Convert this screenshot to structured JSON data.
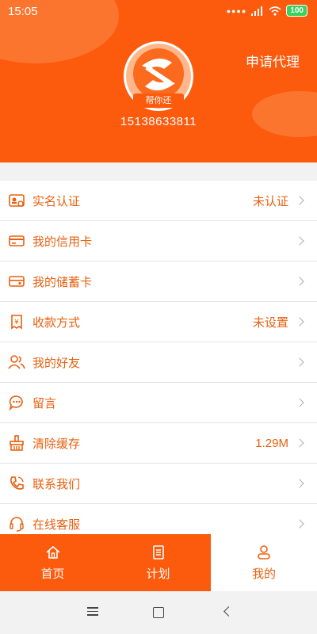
{
  "status_bar": {
    "time": "15:05",
    "battery": "100"
  },
  "header": {
    "apply_agent_label": "申请代理",
    "avatar_text": "帮你还",
    "phone": "15138633811"
  },
  "menu": {
    "items": [
      {
        "label": "实名认证",
        "value": "未认证",
        "icon": "id-card-icon"
      },
      {
        "label": "我的信用卡",
        "value": "",
        "icon": "credit-card-icon"
      },
      {
        "label": "我的储蓄卡",
        "value": "",
        "icon": "debit-card-icon"
      },
      {
        "label": "收款方式",
        "value": "未设置",
        "icon": "yen-receipt-icon"
      },
      {
        "label": "我的好友",
        "value": "",
        "icon": "friends-icon"
      },
      {
        "label": "留言",
        "value": "",
        "icon": "message-icon"
      },
      {
        "label": "清除缓存",
        "value": "1.29M",
        "icon": "broom-icon"
      },
      {
        "label": "联系我们",
        "value": "",
        "icon": "phone-icon"
      },
      {
        "label": "在线客服",
        "value": "",
        "icon": "headset-icon"
      }
    ]
  },
  "tabs": [
    {
      "label": "首页",
      "icon": "home-icon"
    },
    {
      "label": "计划",
      "icon": "plan-icon"
    },
    {
      "label": "我的",
      "icon": "profile-icon"
    }
  ],
  "colors": {
    "brand": "#fc5a0c",
    "text_accent": "#e8600f"
  }
}
